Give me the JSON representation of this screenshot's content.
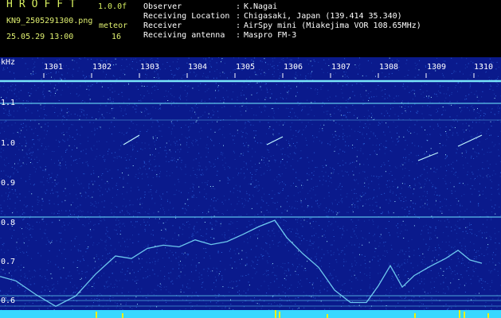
{
  "header": {
    "app_title": "HROFFT",
    "version": "1.0.0f",
    "filename": "KN9_2505291300.png",
    "datetime": "25.05.29 13:00",
    "meteor_label": "meteor",
    "meteor_count": "16",
    "meta": [
      {
        "label": "Observer",
        "value": "K.Nagai"
      },
      {
        "label": "Receiving Location",
        "value": "Chigasaki, Japan (139.414 35.340)"
      },
      {
        "label": "Receiver",
        "value": "AirSpy mini (Miakejima VOR 108.65MHz)"
      },
      {
        "label": "Receiving antenna",
        "value": "Maspro FM-3"
      }
    ]
  },
  "spectrogram": {
    "y_unit": "kHz",
    "y_ticks": [
      "1.1",
      "1.0",
      "0.9",
      "0.8",
      "0.7",
      "0.6"
    ],
    "x_ticks": [
      "1301",
      "1302",
      "1303",
      "1304",
      "1305",
      "1306",
      "1307",
      "1308",
      "1309",
      "1310"
    ],
    "colors": {
      "background": "#0a1a8c",
      "noise": "#2a60d8",
      "carrier": "#6fe8ff",
      "bottom_band": "#38d8ff",
      "bursts": "#f0f000"
    }
  }
}
